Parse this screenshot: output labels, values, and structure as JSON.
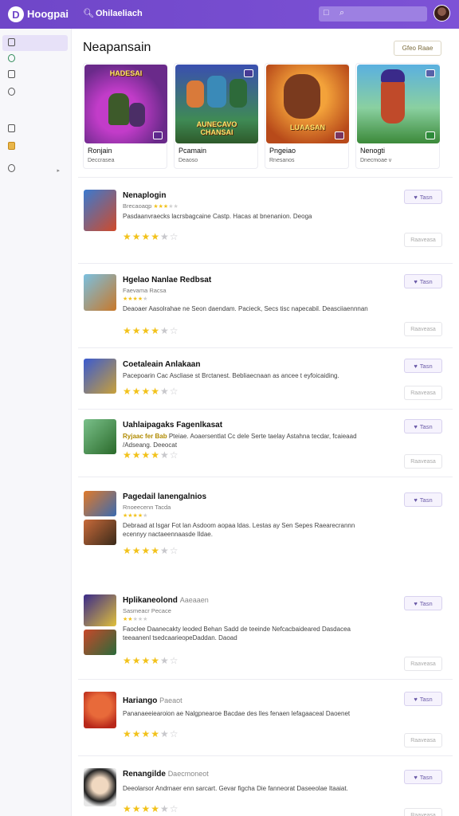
{
  "topbar": {
    "brand": "Hoogpai",
    "search_label": "Ohilaeliach",
    "accent": "#6f46c8"
  },
  "sidebar": {
    "items": [
      {
        "icon": "grid-icon",
        "active": true
      },
      {
        "icon": "leaf-icon"
      },
      {
        "icon": "doc-icon"
      },
      {
        "icon": "chat-icon"
      },
      {
        "icon": "lock-icon"
      },
      {
        "icon": "folder-icon"
      },
      {
        "icon": "settings-icon"
      }
    ]
  },
  "main": {
    "title": "Neapansain",
    "top_button": "Gfeo Raae",
    "featured": [
      {
        "art": "HADESAI",
        "name": "Ronjain",
        "sub": "Deccrasea"
      },
      {
        "art": "AUNECAVO CHANSAI",
        "name": "Pcamain",
        "sub": "Deaoso"
      },
      {
        "art": "LUAASAN",
        "name": "Pngeiao",
        "sub": "Rnesanos"
      },
      {
        "art": "",
        "name": "Nenogti",
        "sub": "Dnecmoae v"
      }
    ],
    "list": [
      {
        "title": "Nenaplogin",
        "title_light": "",
        "meta": "Brecaoaqp",
        "desc": "Pasdaanvraecks lacrsbagcaine Castp. Hacas at bnenanion. Deoga",
        "desc_highlight": "",
        "rating": 4,
        "install": "Tasn",
        "secondary": "Raaveasa"
      },
      {
        "title": "Hgelao Nanlae Redbsat",
        "title_light": "",
        "meta": "Faevama Racsa",
        "desc": "Deaoaer Aasolrahae ne Seon daendam. Pacieck, Secs tisc napecabil. Deasciiaennnan",
        "desc_highlight": "",
        "rating": 4,
        "install": "Tasn",
        "secondary": "Raaveasa"
      },
      {
        "title": "Coetaleain Anlakaan",
        "title_light": "",
        "meta": "",
        "desc": "Pacepoarin Cac Ascliase st Brctanest. Bebliaecnaan as ancee t eyfoicaiding.",
        "desc_highlight": "",
        "rating": 4,
        "install": "Tasn",
        "secondary": "Raaveasa"
      },
      {
        "title": "Uahlaipagaks Fagenlkasat",
        "title_light": "",
        "meta": "",
        "desc": "Pteiae. Aoaersentlat Cc dele Serte taelay Astahna tecdar, fcaieaad /Adseang. Deeocat",
        "desc_highlight": "Ryjaac fer Bab",
        "rating": 4,
        "install": "Tasn",
        "secondary": "Raaveasa"
      },
      {
        "title": "Pagedail lanengalnios",
        "title_light": "",
        "meta": "Rnoeecenn Tacda",
        "desc": "Debraad at lsgar Fot lan Asdoom aopaa ldas. Lestas ay Sen Sepes Raearecrannn ecennyy nactaeennaasde Ildae.",
        "desc_highlight": "",
        "rating": 4,
        "install": "Tasn",
        "secondary": ""
      },
      {
        "title": "Hplikaneolond",
        "title_light": "Aaeaaen",
        "meta": "Sasmeacr Pecace",
        "desc": "Faoclee Daanecakty leoded Behan Sadd de teeinde Nefcacbaideared Dasdacea teeaanenl tsedcaarieopeDaddan. Daoad",
        "desc_highlight": "",
        "rating": 4,
        "install": "Tasn",
        "secondary": "Raaveasa"
      },
      {
        "title": "Hariango",
        "title_light": "Paeaot",
        "meta": "",
        "desc": "Pananaeeiearoion ae Nalgpnearoe Bacdae des lles fenaen lefagaaceal Daoenet",
        "desc_highlight": "",
        "rating": 4,
        "install": "Tasn",
        "secondary": "Raaveasa"
      },
      {
        "title": "Renangilde",
        "title_light": "Daecmoneot",
        "meta": "",
        "desc": "Deeolarsor Andrnaer enn sarcart. Gevar figcha Die fanneorat Daseeolae Itaaiat.",
        "desc_highlight": "",
        "rating": 4,
        "install": "Tasn",
        "secondary": "Raaveasa"
      }
    ]
  },
  "colors": {
    "star": "#f2c21b",
    "star_empty": "#c8c8cc",
    "install_text": "#6a5aa8"
  }
}
